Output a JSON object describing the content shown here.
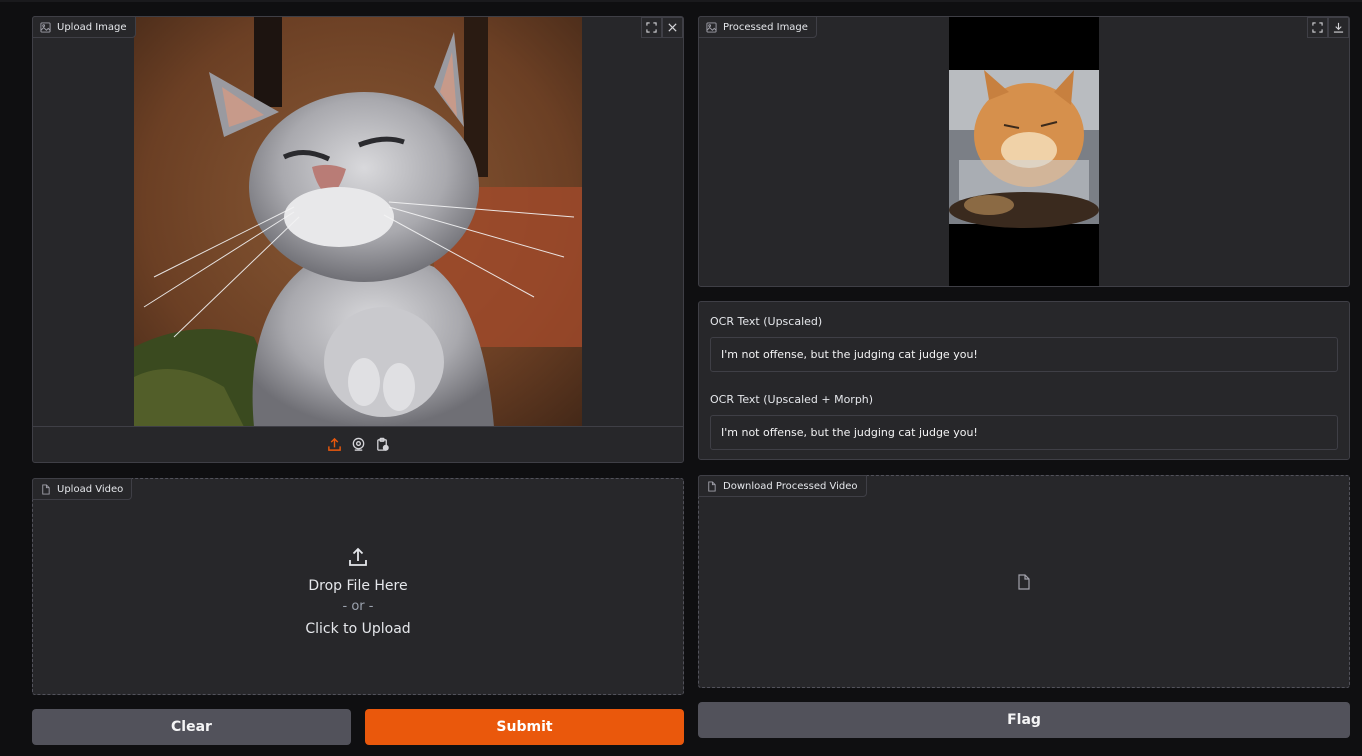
{
  "upload_image": {
    "label": "Upload Image",
    "icons": [
      "image-icon",
      "fullscreen-icon",
      "close-icon",
      "upload-icon",
      "webcam-icon",
      "clipboard-icon"
    ]
  },
  "upload_video": {
    "label": "Upload Video",
    "drop_text": "Drop File Here",
    "or_text": "- or -",
    "click_text": "Click to Upload"
  },
  "processed_image": {
    "label": "Processed Image"
  },
  "ocr": {
    "label_upscaled": "OCR Text (Upscaled)",
    "value_upscaled": "I'm not offense, but the judging cat judge you!",
    "label_morph": "OCR Text (Upscaled + Morph)",
    "value_morph": "I'm not offense, but the judging cat judge you!"
  },
  "download_video": {
    "label": "Download Processed Video"
  },
  "buttons": {
    "clear": "Clear",
    "submit": "Submit",
    "flag": "Flag"
  },
  "colors": {
    "background": "#0f0f11",
    "panel": "#27272a",
    "border": "#3f3f46",
    "accent": "#ea580c",
    "secondary_button": "#52525b"
  }
}
